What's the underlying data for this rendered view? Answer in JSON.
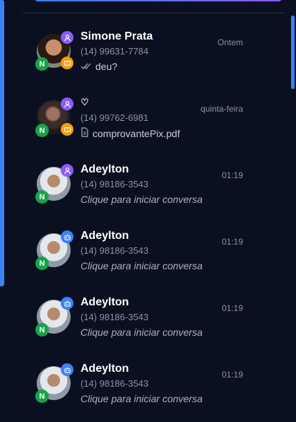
{
  "colors": {
    "background": "#0b1020",
    "accent": "#3b82f6",
    "user_badge": "#8b5cf6",
    "n_badge": "#16a34a",
    "ticket_badge": "#f59e0b"
  },
  "conversations": [
    {
      "name": "Simone Prata",
      "phone": "(14) 99631-7784",
      "time": "Ontem",
      "message": "deu?",
      "message_icon": "double-check-icon",
      "agent_icon": "user-icon",
      "channel_badge": "N",
      "extra_badge": "ticket-icon"
    },
    {
      "name": "♡",
      "phone": "(14) 99762-6981",
      "time": "quinta-feira",
      "message": "comprovantePix.pdf",
      "message_icon": "document-icon",
      "agent_icon": "user-icon",
      "channel_badge": "N",
      "extra_badge": "ticket-icon"
    },
    {
      "name": "Adeylton",
      "phone": "(14) 98186-3543",
      "time": "01:19",
      "message": "Clique para iniciar conversa",
      "agent_icon": "user-icon",
      "channel_badge": "N"
    },
    {
      "name": "Adeylton",
      "phone": "(14) 98186-3543",
      "time": "01:19",
      "message": "Clique para iniciar conversa",
      "agent_icon": "robot-icon",
      "channel_badge": "N"
    },
    {
      "name": "Adeylton",
      "phone": "(14) 98186-3543",
      "time": "01:19",
      "message": "Clique para iniciar conversa",
      "agent_icon": "robot-icon",
      "channel_badge": "N"
    },
    {
      "name": "Adeylton",
      "phone": "(14) 98186-3543",
      "time": "01:19",
      "message": "Clique para iniciar conversa",
      "agent_icon": "robot-icon",
      "channel_badge": "N"
    }
  ]
}
